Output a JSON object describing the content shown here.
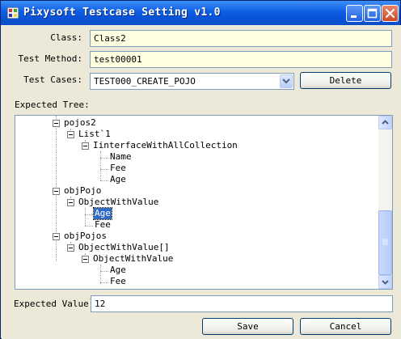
{
  "window": {
    "title": "Pixysoft Testcase Setting v1.0"
  },
  "form": {
    "class_label": "Class:",
    "class_value": "Class2",
    "test_method_label": "Test Method:",
    "test_method_value": "test00001",
    "test_cases_label": "Test Cases:",
    "test_cases_selected": "TEST000_CREATE_POJO",
    "delete_label": "Delete",
    "expected_tree_label": "Expected Tree:",
    "expected_value_label": "Expected Value:",
    "expected_value": "12",
    "save_label": "Save",
    "cancel_label": "Cancel"
  },
  "tree": {
    "nodes": [
      {
        "text": "pojos2",
        "expander": true
      },
      {
        "text": "List`1",
        "expander": true
      },
      {
        "text": "IinterfaceWithAllCollection",
        "expander": true
      },
      {
        "text": "Name",
        "expander": false
      },
      {
        "text": "Fee",
        "expander": false
      },
      {
        "text": "Age",
        "expander": false
      },
      {
        "text": "objPojo",
        "expander": true
      },
      {
        "text": "ObjectWithValue",
        "expander": true
      },
      {
        "text": "Age",
        "expander": false,
        "selected": true
      },
      {
        "text": "Fee",
        "expander": false
      },
      {
        "text": "objPojos",
        "expander": true
      },
      {
        "text": "ObjectWithValue[]",
        "expander": true
      },
      {
        "text": "ObjectWithValue",
        "expander": true
      },
      {
        "text": "Age",
        "expander": false
      },
      {
        "text": "Fee",
        "expander": false
      }
    ]
  },
  "colors": {
    "titlebar": "#0a53d6",
    "selection": "#316ac5",
    "field_background": "#ffffe1"
  }
}
